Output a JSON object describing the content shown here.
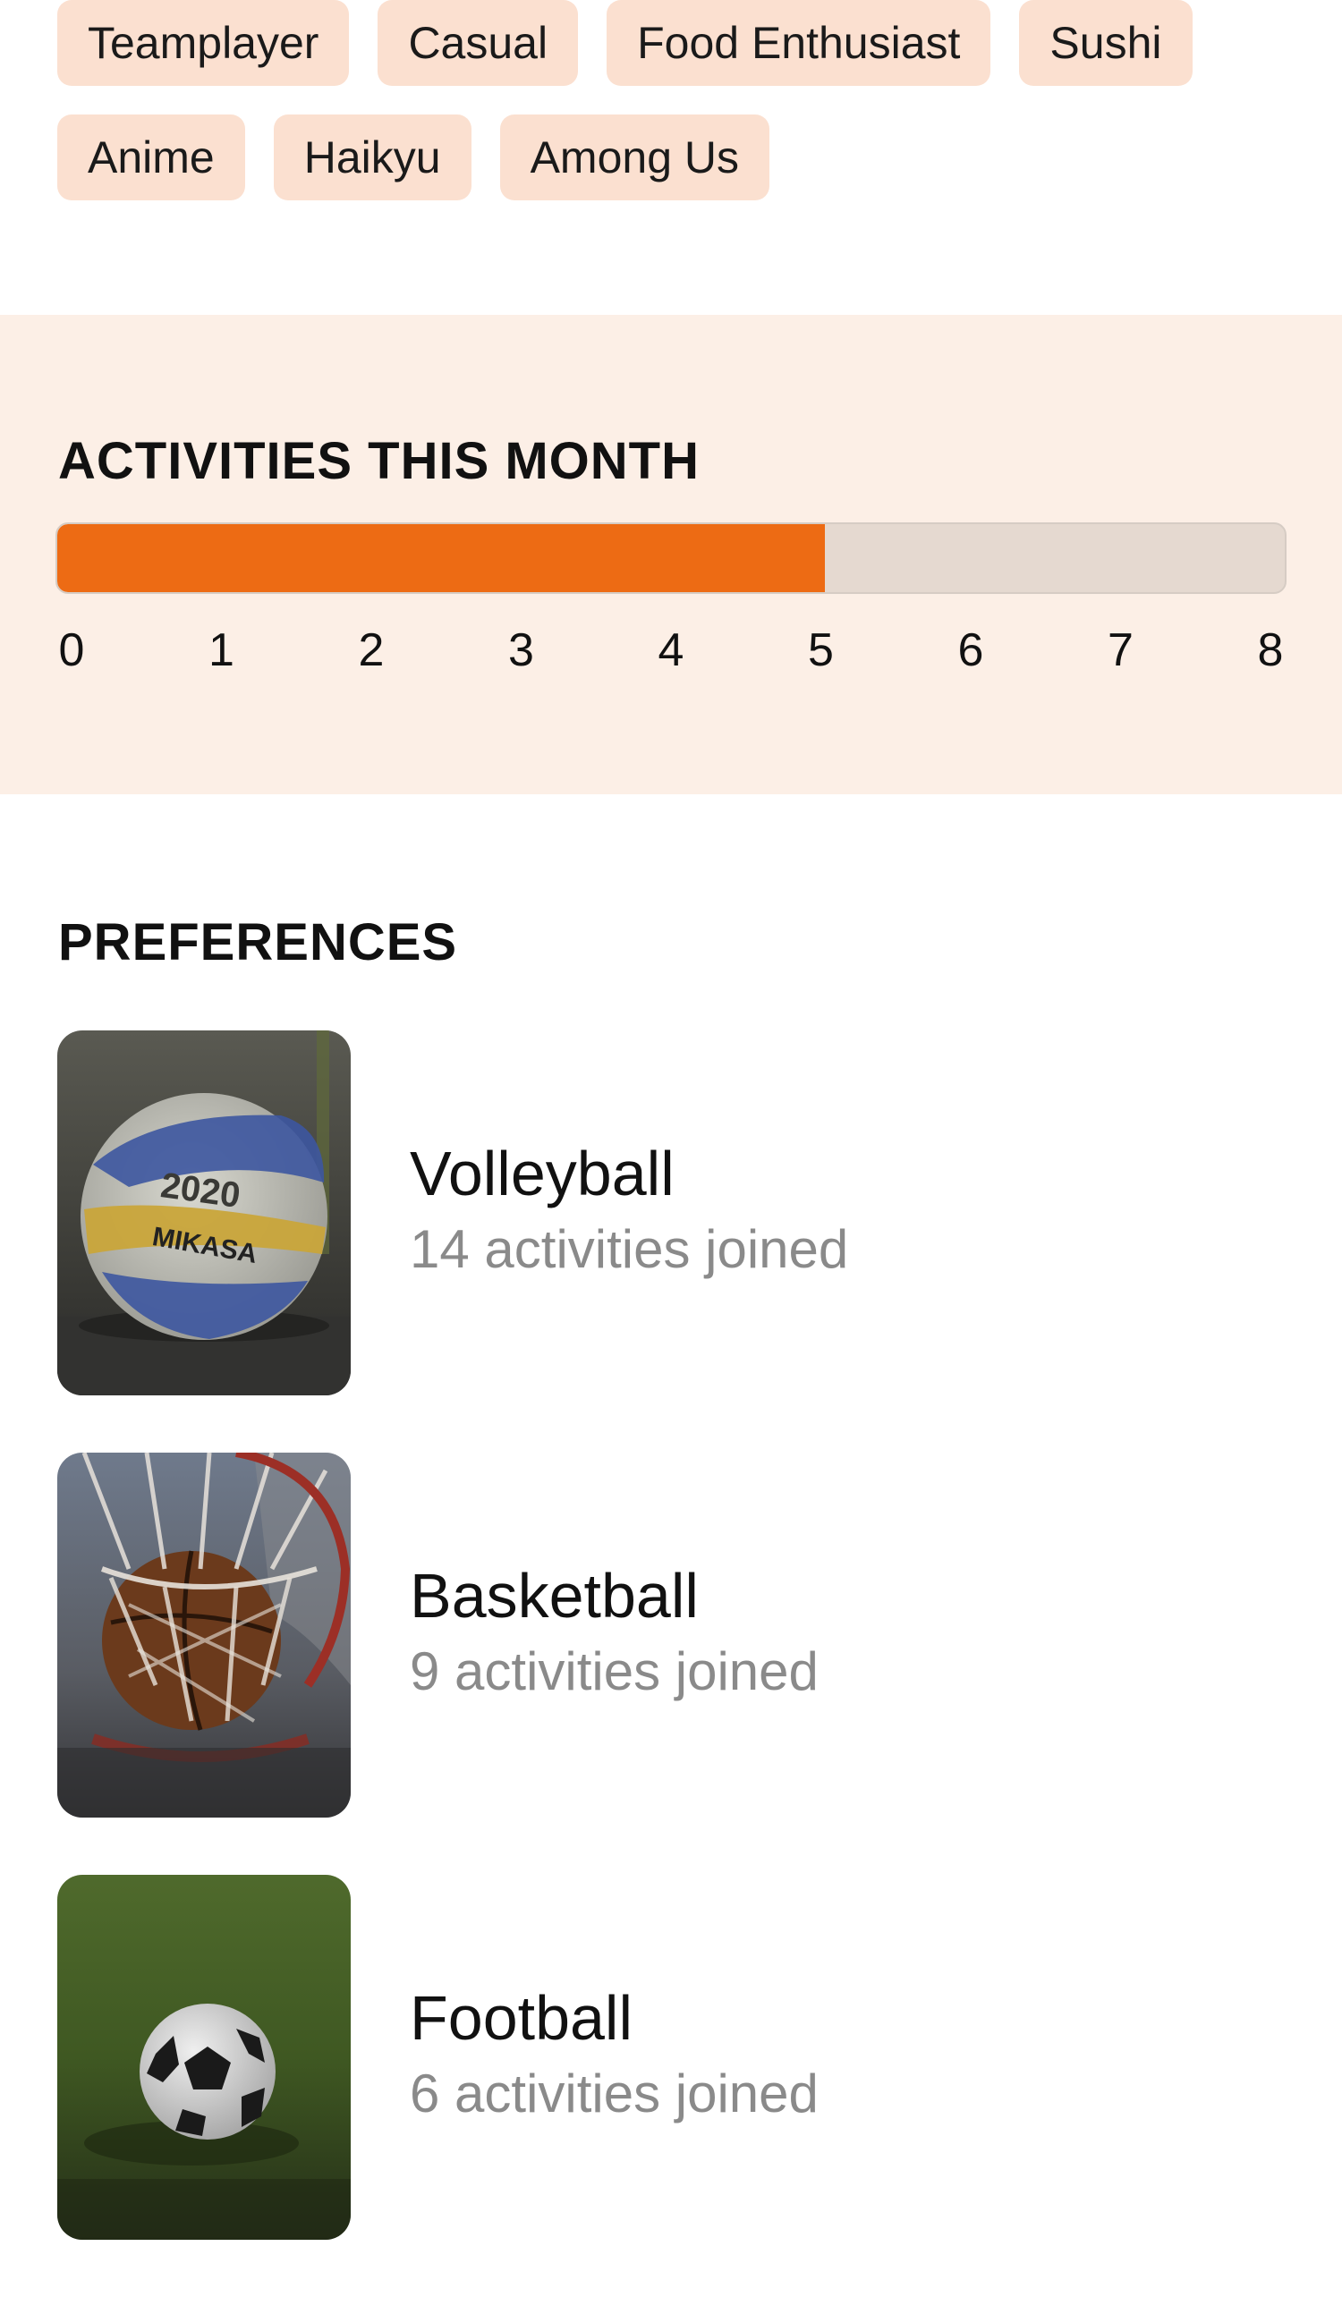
{
  "tags": {
    "rows": [
      [
        "Teamplayer",
        "Casual",
        "Food Enthusiast",
        "Sushi"
      ],
      [
        "Anime",
        "Haikyu",
        "Among Us"
      ]
    ]
  },
  "activity": {
    "title": "ACTIVITIES THIS MONTH",
    "value": 5,
    "max": 8,
    "scale_labels": [
      "0",
      "1",
      "2",
      "3",
      "4",
      "5",
      "6",
      "7",
      "8"
    ],
    "colors": {
      "fill": "#ed6b14",
      "track": "#e5d9d0",
      "panel": "#fcefe6"
    }
  },
  "preferences": {
    "title": "PREFERENCES",
    "items": [
      {
        "name": "Volleyball",
        "count_text": "14 activities joined",
        "image": "volleyball-photo",
        "ball_text_1": "2020",
        "ball_text_2": "MIKASA"
      },
      {
        "name": "Basketball",
        "count_text": "9 activities joined",
        "image": "basketball-hoop-photo"
      },
      {
        "name": "Football",
        "count_text": "6 activities joined",
        "image": "football-on-grass-photo"
      }
    ]
  },
  "colors": {
    "tag_bg": "#fbe0d0",
    "secondary_text": "#8a8a8a"
  }
}
